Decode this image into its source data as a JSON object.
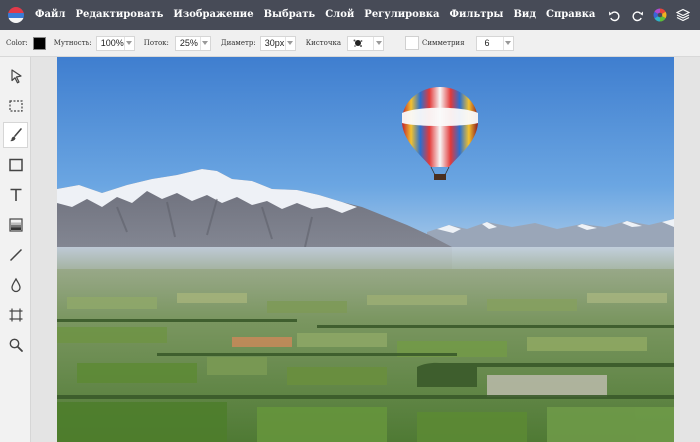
{
  "menu": {
    "items": [
      "Файл",
      "Редактировать",
      "Изображение",
      "Выбрать",
      "Слой",
      "Регулировка",
      "Фильтры",
      "Вид",
      "Справка"
    ]
  },
  "options": {
    "color_label": "Color:",
    "opacity_label": "Мутность:",
    "opacity_value": "100%",
    "flow_label": "Поток:",
    "flow_value": "25%",
    "diameter_label": "Диаметр:",
    "diameter_value": "30px",
    "brush_label": "Кисточка",
    "symmetry_label": "Симметрия",
    "symmetry_value": "6"
  },
  "colors": {
    "menubar_bg": "#474b57",
    "current_color": "#000000"
  },
  "icons": {
    "right": [
      "undo-icon",
      "redo-icon",
      "color-wheel-icon",
      "layers-icon"
    ],
    "tools": [
      "select-arrow-icon",
      "marquee-icon",
      "brush-icon",
      "rectangle-icon",
      "text-icon",
      "gradient-icon",
      "line-icon",
      "drop-icon",
      "crop-icon",
      "zoom-icon"
    ]
  }
}
